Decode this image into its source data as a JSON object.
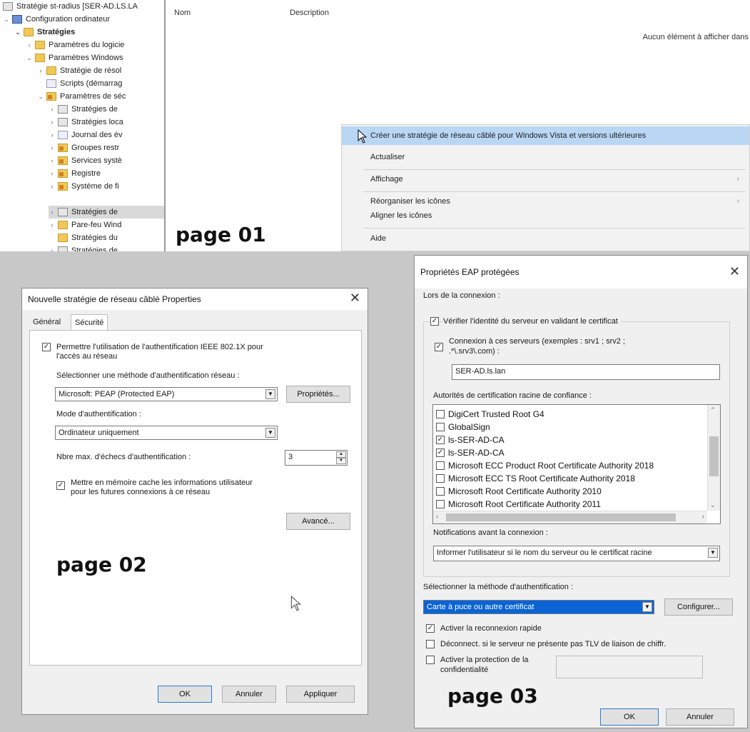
{
  "page01": {
    "label": "page 01",
    "tree": {
      "items": [
        {
          "label": "Stratégie st-radius [SER-AD.LS.LA",
          "icon": "policy-icon"
        },
        {
          "label": "Configuration ordinateur",
          "icon": "computer-icon"
        },
        {
          "label": "Stratégies",
          "icon": "folder-icon"
        },
        {
          "label": "Paramètres du logicie",
          "icon": "folder-icon"
        },
        {
          "label": "Paramètres Windows",
          "icon": "folder-icon"
        },
        {
          "label": "Stratégie de résol",
          "icon": "folder-icon"
        },
        {
          "label": "Scripts (démarrag",
          "icon": "script-icon"
        },
        {
          "label": "Paramètres de séc",
          "icon": "security-icon"
        },
        {
          "label": "Stratégies de",
          "icon": "policy-icon"
        },
        {
          "label": "Stratégies loca",
          "icon": "policy-icon"
        },
        {
          "label": "Journal des év",
          "icon": "log-icon"
        },
        {
          "label": "Groupes restr",
          "icon": "security-icon"
        },
        {
          "label": "Services systè",
          "icon": "security-icon"
        },
        {
          "label": "Registre",
          "icon": "security-icon"
        },
        {
          "label": "Système de fi",
          "icon": "security-icon"
        },
        {
          "label": "Stratégies de",
          "icon": "policy-icon"
        },
        {
          "label": "Pare-feu Wind",
          "icon": "folder-icon"
        },
        {
          "label": "Stratégies du",
          "icon": "folder-icon"
        },
        {
          "label": "Stratégies de",
          "icon": "policy-icon"
        }
      ]
    },
    "list": {
      "col_name": "Nom",
      "col_description": "Description",
      "empty_message": "Aucun élément à afficher dans"
    },
    "context_menu": {
      "create": "Créer une stratégie de réseau câblé pour Windows Vista et versions ultérieures",
      "refresh": "Actualiser",
      "view": "Affichage",
      "arrange": "Réorganiser les icônes",
      "align": "Aligner les icônes",
      "help": "Aide"
    }
  },
  "page02": {
    "label": "page 02",
    "title": "Nouvelle stratégie de réseau câblé Properties",
    "tabs": [
      "Général",
      "Sécurité"
    ],
    "enable_8021x_line1": "Permettre l'utilisation de l'authentification IEEE 802.1X pour",
    "enable_8021x_line2": "l'accès au réseau",
    "auth_method_label": "Sélectionner une méthode d'authentification réseau :",
    "auth_method_value": "Microsoft: PEAP (Protected EAP)",
    "properties_button": "Propriétés...",
    "auth_mode_label": "Mode d'authentification :",
    "auth_mode_value": "Ordinateur uniquement",
    "max_failures_label": "Nbre max. d'échecs d'authentification :",
    "max_failures_value": "3",
    "cache_line1": "Mettre en mémoire cache les informations utilisateur",
    "cache_line2": "pour les futures connexions à ce réseau",
    "advanced_button": "Avancé...",
    "ok_button": "OK",
    "cancel_button": "Annuler",
    "apply_button": "Appliquer"
  },
  "page03": {
    "label": "page 03",
    "title": "Propriétés EAP protégées",
    "on_connect_label": "Lors de la connexion :",
    "verify_server": "Vérifier l'identité du serveur en validant le certificat",
    "connect_servers_line1": "Connexion à ces serveurs (exemples : srv1 ; srv2 ;",
    "connect_servers_line2": ".*\\.srv3\\.com) :",
    "servers_value": "SER-AD.ls.lan",
    "root_ca_label": "Autorités de certification racine de confiance :",
    "root_cas": [
      {
        "name": "DigiCert Trusted Root G4",
        "checked": false
      },
      {
        "name": "GlobalSign",
        "checked": false
      },
      {
        "name": "ls-SER-AD-CA",
        "checked": true
      },
      {
        "name": "ls-SER-AD-CA",
        "checked": true
      },
      {
        "name": "Microsoft ECC Product Root Certificate Authority 2018",
        "checked": false
      },
      {
        "name": "Microsoft ECC TS Root Certificate Authority 2018",
        "checked": false
      },
      {
        "name": "Microsoft Root Certificate Authority 2010",
        "checked": false
      },
      {
        "name": "Microsoft Root Certificate Authority 2011",
        "checked": false
      }
    ],
    "notifications_label": "Notifications avant la connexion :",
    "notifications_value": "Informer l'utilisateur si le nom du serveur ou le certificat racine",
    "auth_method_label": "Sélectionner la méthode d'authentification :",
    "auth_method_value": "Carte à puce ou autre certificat",
    "configure_button": "Configurer...",
    "fast_reconnect": "Activer la reconnexion rapide",
    "disconnect_tlv": "Déconnect. si le serveur ne présente pas TLV de liaison de chiffr.",
    "privacy_line1": "Activer la protection de la",
    "privacy_line2": "confidentialité",
    "ok_button": "OK",
    "cancel_button": "Annuler"
  }
}
